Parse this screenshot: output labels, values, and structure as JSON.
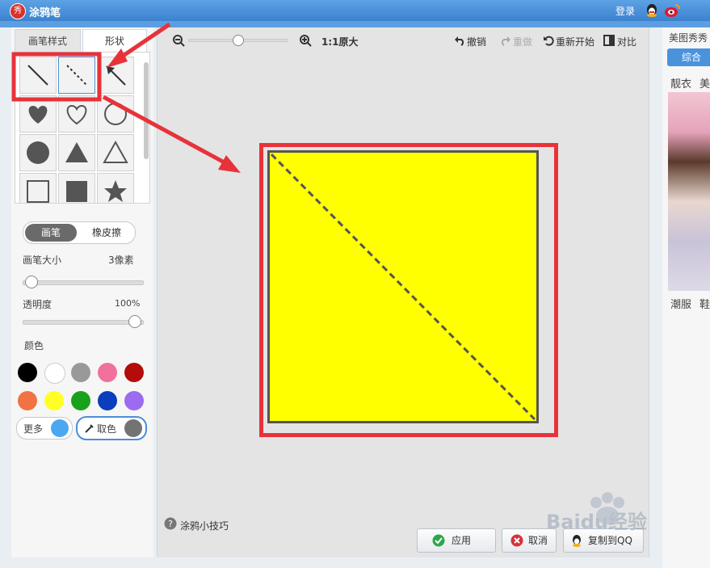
{
  "window": {
    "title": "涂鸦笔",
    "login": "登录"
  },
  "left_panel": {
    "tabs": [
      "画笔样式",
      "形状"
    ],
    "mode": {
      "brush": "画笔",
      "eraser": "橡皮擦"
    },
    "brush_size": {
      "label": "画笔大小",
      "value": "3像素"
    },
    "opacity": {
      "label": "透明度",
      "value": "100%"
    },
    "color_label": "颜色",
    "palette": [
      "#000000",
      "#ffffff",
      "#999999",
      "#f0719b",
      "#b40b0b",
      "#f27244",
      "#ffff26",
      "#19a11c",
      "#0a3ebd",
      "#9b6bf0"
    ],
    "more_label": "更多",
    "more_color": "#4aa8f0",
    "pick_label": "取色",
    "pick_color": "#737373"
  },
  "toolbar": {
    "zoom_label": "1:1原大",
    "undo": "撤销",
    "redo": "重做",
    "restart": "重新开始",
    "compare": "对比"
  },
  "canvas_colors": {
    "fill": "#ffff00",
    "highlight": "#e8323a"
  },
  "bottom": {
    "tips": "涂鸦小技巧",
    "apply": "应用",
    "cancel": "取消",
    "copy": "复制到QQ"
  },
  "right_panel": {
    "title": "美图秀秀",
    "button": "综合",
    "tab_top": "靓衣",
    "tab_top2": "美",
    "tab_bottom": "潮服",
    "tab_bottom2": "鞋"
  },
  "watermark": "Baidu经验"
}
